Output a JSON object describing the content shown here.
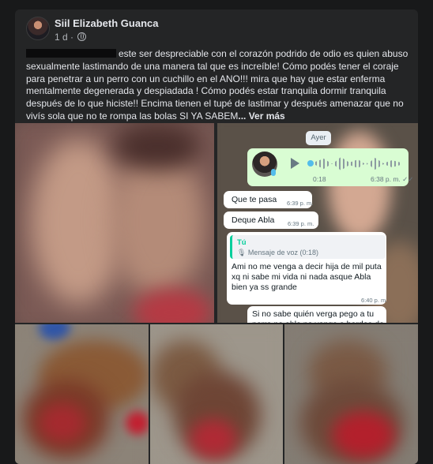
{
  "post": {
    "author": "Siil Elizabeth Guanca",
    "time": "1 d ·",
    "text": "este ser despreciable con el corazón podrido de odio es quien abuso sexualmente lastimando de una manera tal que es increíble! Cómo podés tener el coraje para penetrar a un perro con un cuchillo en el ANO!!! mira que hay que estar enferma mentalmente degenerada y despiadada ! Cómo podés estar tranquila dormir tranquila después de lo que hiciste!! Encima tienen el tupé de lastimar y después amenazar que no vivís sola que no te rompa las bolas SI YA SABEM",
    "see_more": "... Ver más"
  },
  "icons": {
    "privacy": "globe-icon",
    "voice_play": "play-icon",
    "voice_mic": "microphone-icon"
  },
  "chat": {
    "day": "Ayer",
    "voice_note": {
      "duration": "0:18",
      "time": "6:38 p. m. ✓✓"
    },
    "messages": [
      {
        "text": "Que te pasa",
        "time": "6:39 p. m."
      },
      {
        "text": "Deque Abla",
        "time": "6:39 p. m."
      },
      {
        "quote_author": "Tú",
        "quote_text": "🎙 Mensaje de voz (0:18)",
        "text": "Ami no me venga a decir hija de mil puta xq ni sabe mi vida ni nada asque Abla bien ya ss grande",
        "time": "6:40 p. m."
      },
      {
        "text": "Si no sabe quién verga pego a tu perro no able no venga a bardea de la"
      }
    ]
  },
  "colors": {
    "background": "#18191a",
    "card": "#242526",
    "text": "#e4e6eb",
    "muted": "#b0b3b8",
    "chat_outgoing": "#d9fdd3",
    "chat_accent": "#06cf9c"
  }
}
